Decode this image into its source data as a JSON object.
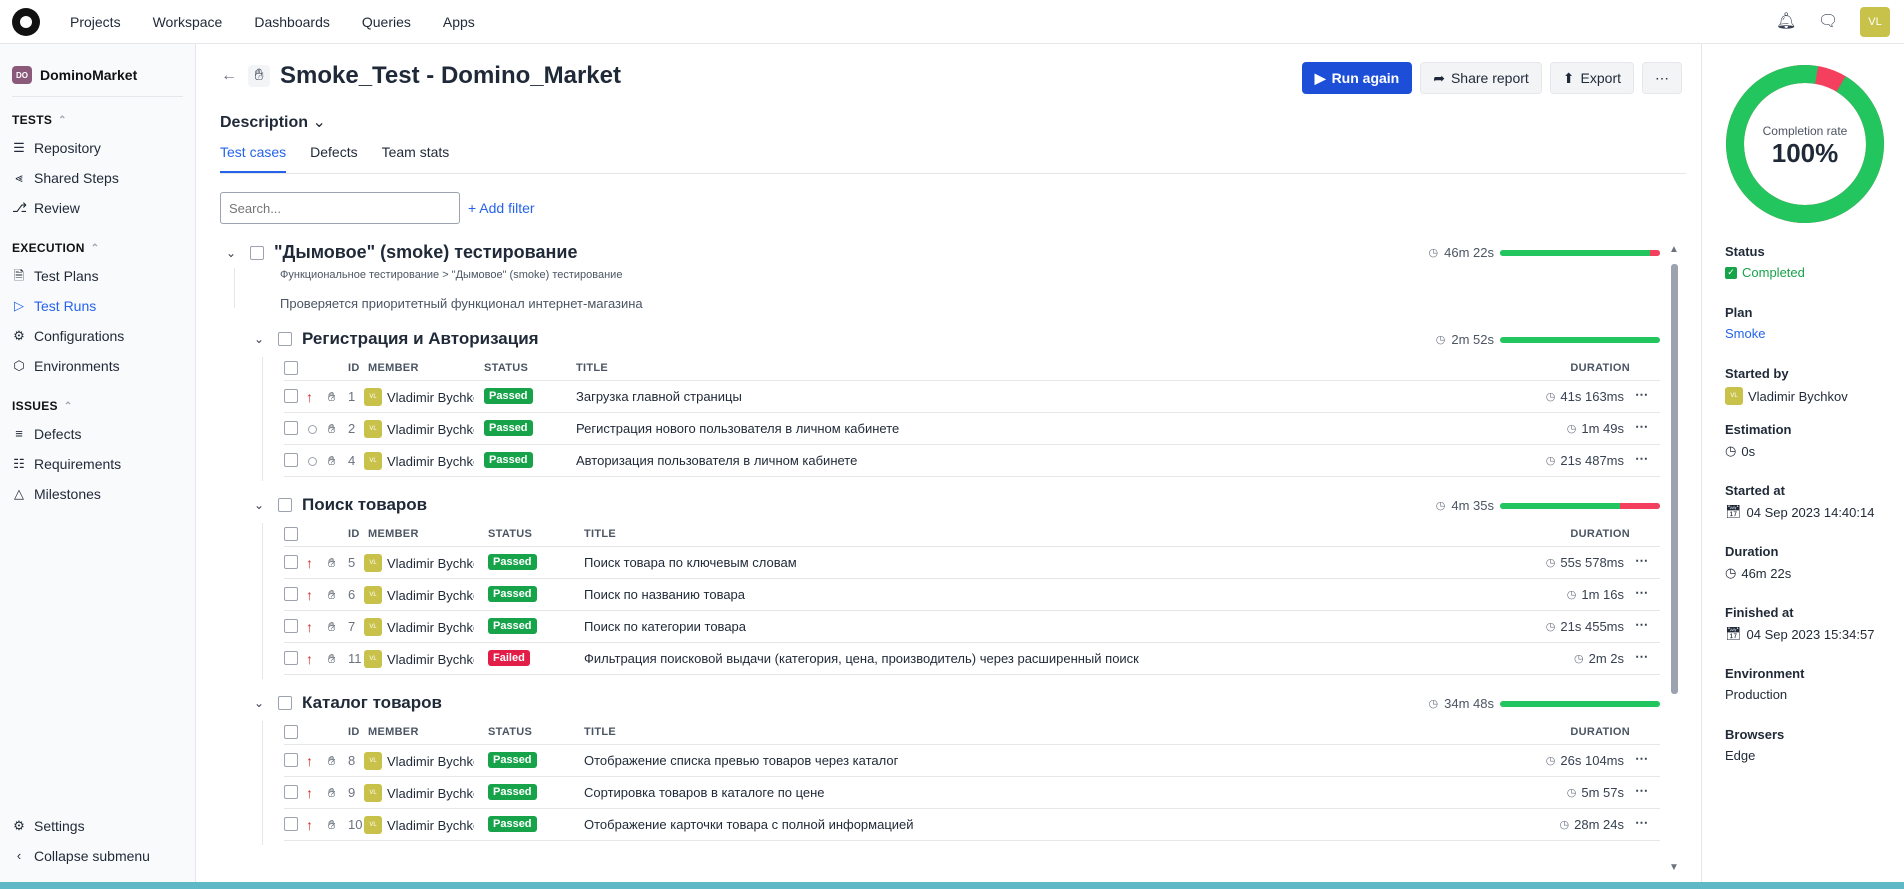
{
  "topnav": [
    "Projects",
    "Workspace",
    "Dashboards",
    "Queries",
    "Apps"
  ],
  "user_initials": "VL",
  "project": {
    "name": "DominoMarket",
    "badge": "DO"
  },
  "sidebar": {
    "tests_label": "TESTS",
    "tests_items": [
      "Repository",
      "Shared Steps",
      "Review"
    ],
    "execution_label": "EXECUTION",
    "execution_items": [
      "Test Plans",
      "Test Runs",
      "Configurations",
      "Environments"
    ],
    "issues_label": "ISSUES",
    "issues_items": [
      "Defects",
      "Requirements",
      "Milestones"
    ],
    "settings": "Settings",
    "collapse": "Collapse submenu"
  },
  "header": {
    "title": "Smoke_Test - Domino_Market",
    "run_again": "Run again",
    "share": "Share report",
    "export": "Export"
  },
  "description_label": "Description",
  "tabs": [
    "Test cases",
    "Defects",
    "Team stats"
  ],
  "search_placeholder": "Search...",
  "add_filter": "+ Add filter",
  "root_suite": {
    "title": "\"Дымовое\" (smoke) тестирование",
    "time": "46m 22s",
    "breadcrumb": "Функциональное тестирование > \"Дымовое\" (smoke) тестирование",
    "description": "Проверяется приоритетный функционал интернет-магазина",
    "passed_fraction": 0.94
  },
  "columns": {
    "id": "ID",
    "member": "MEMBER",
    "status": "STATUS",
    "title": "TITLE",
    "duration": "DURATION"
  },
  "suites": [
    {
      "title": "Регистрация и Авторизация",
      "time": "2m 52s",
      "passed_fraction": 1.0,
      "rows": [
        {
          "id": "1",
          "priority": "high",
          "member": "Vladimir Bychkov",
          "status": "Passed",
          "title": "Загрузка главной страницы",
          "duration": "41s 163ms"
        },
        {
          "id": "2",
          "priority": "none",
          "member": "Vladimir Bychkov",
          "status": "Passed",
          "title": "Регистрация нового пользователя в личном кабинете",
          "duration": "1m 49s"
        },
        {
          "id": "4",
          "priority": "none",
          "member": "Vladimir Bychkov",
          "status": "Passed",
          "title": "Авторизация пользователя в личном кабинете",
          "duration": "21s 487ms"
        }
      ]
    },
    {
      "title": "Поиск товаров",
      "time": "4m 35s",
      "passed_fraction": 0.75,
      "rows": [
        {
          "id": "5",
          "priority": "high",
          "member": "Vladimir Bychkov",
          "status": "Passed",
          "title": "Поиск товара по ключевым словам",
          "duration": "55s 578ms"
        },
        {
          "id": "6",
          "priority": "high",
          "member": "Vladimir Bychkov",
          "status": "Passed",
          "title": "Поиск по названию товара",
          "duration": "1m 16s"
        },
        {
          "id": "7",
          "priority": "high",
          "member": "Vladimir Bychkov",
          "status": "Passed",
          "title": "Поиск по категории товара",
          "duration": "21s 455ms"
        },
        {
          "id": "11",
          "priority": "high",
          "member": "Vladimir Bychkov",
          "status": "Failed",
          "title": "Фильтрация поисковой выдачи (категория, цена, производитель) через расширенный поиск",
          "duration": "2m 2s"
        }
      ]
    },
    {
      "title": "Каталог товаров",
      "time": "34m 48s",
      "passed_fraction": 1.0,
      "rows": [
        {
          "id": "8",
          "priority": "high",
          "member": "Vladimir Bychkov",
          "status": "Passed",
          "title": "Отображение списка превью товаров через каталог",
          "duration": "26s 104ms"
        },
        {
          "id": "9",
          "priority": "high",
          "member": "Vladimir Bychkov",
          "status": "Passed",
          "title": "Сортировка товаров в каталоге по цене",
          "duration": "5m 57s"
        },
        {
          "id": "10",
          "priority": "high",
          "member": "Vladimir Bychkov",
          "status": "Passed",
          "title": "Отображение карточки товара с полной информацией",
          "duration": "28m 24s"
        }
      ]
    }
  ],
  "panel": {
    "completion_label": "Completion rate",
    "completion_value": "100%",
    "passed_fraction": 0.94,
    "status_k": "Status",
    "status_v": "Completed",
    "plan_k": "Plan",
    "plan_v": "Smoke",
    "started_by_k": "Started by",
    "started_by_v": "Vladimir Bychkov",
    "estimation_k": "Estimation",
    "estimation_v": "0s",
    "started_at_k": "Started at",
    "started_at_v": "04 Sep 2023 14:40:14",
    "duration_k": "Duration",
    "duration_v": "46m 22s",
    "finished_at_k": "Finished at",
    "finished_at_v": "04 Sep 2023 15:34:57",
    "environment_k": "Environment",
    "environment_v": "Production",
    "browsers_k": "Browsers",
    "browsers_v": "Edge"
  },
  "colors": {
    "accent": "#1d4ed8",
    "passed": "#16a34a",
    "failed": "#e11d48",
    "bar_green": "#22c55e",
    "bar_red": "#f43f5e"
  }
}
